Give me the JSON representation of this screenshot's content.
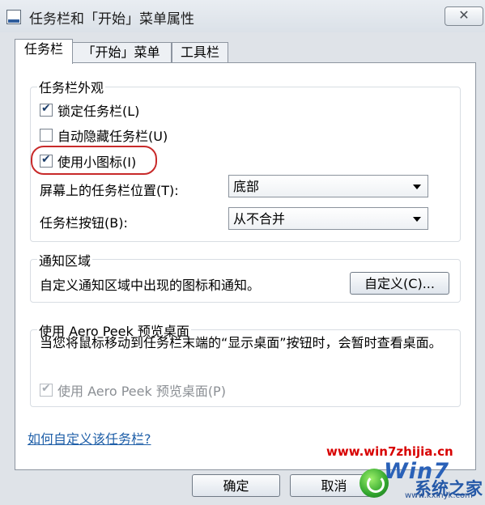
{
  "window": {
    "title": "任务栏和「开始」菜单属性",
    "close_label": "✕"
  },
  "tabs": [
    {
      "label": "任务栏"
    },
    {
      "label": "「开始」菜单"
    },
    {
      "label": "工具栏"
    }
  ],
  "appearance": {
    "title": "任务栏外观",
    "lock_taskbar": {
      "label": "锁定任务栏(L)",
      "checked": true
    },
    "autohide": {
      "label": "自动隐藏任务栏(U)",
      "checked": false
    },
    "small_icons": {
      "label": "使用小图标(I)",
      "checked": true
    },
    "position_label": "屏幕上的任务栏位置(T):",
    "position_value": "底部",
    "buttons_label": "任务栏按钮(B):",
    "buttons_value": "从不合并"
  },
  "notification": {
    "title": "通知区域",
    "description": "自定义通知区域中出现的图标和通知。",
    "customize_button": "自定义(C)..."
  },
  "aero_peek": {
    "title": "使用 Aero Peek 预览桌面",
    "description": "当您将鼠标移动到任务栏末端的“显示桌面”按钮时，会暂时查看桌面。",
    "checkbox": {
      "label": "使用 Aero Peek 预览桌面(P)",
      "checked": true,
      "disabled": true
    }
  },
  "help_link": "如何自定义该任务栏?",
  "footer": {
    "ok": "确定",
    "cancel": "取消"
  },
  "watermark": {
    "url": "www.win7zhijia.cn",
    "logo_text": "Win7",
    "logo_sub": "系统之家",
    "logo_site": "www.kxinyk.com"
  }
}
